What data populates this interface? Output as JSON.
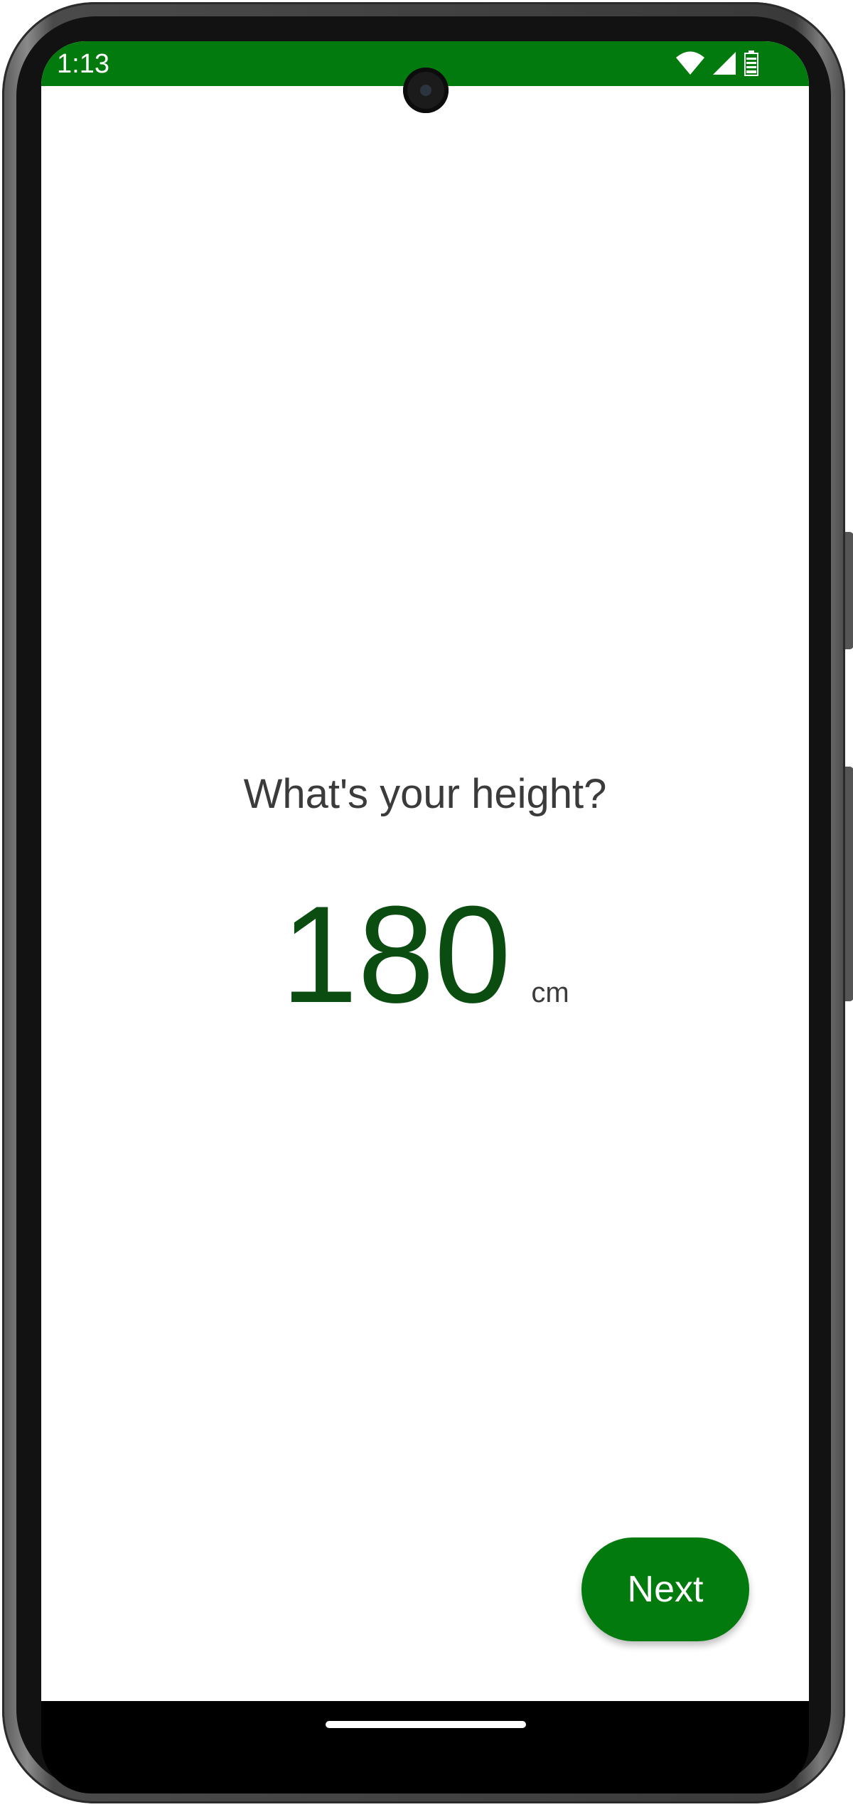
{
  "status_bar": {
    "time": "1:13",
    "color": "#037a0d",
    "icons": [
      "wifi-icon",
      "cellular-signal-icon",
      "battery-icon"
    ]
  },
  "main": {
    "question": "What's your height?",
    "height_value": "180",
    "height_unit": "cm",
    "value_color": "#0b4d10"
  },
  "actions": {
    "next_label": "Next",
    "button_color": "#037a0d"
  }
}
